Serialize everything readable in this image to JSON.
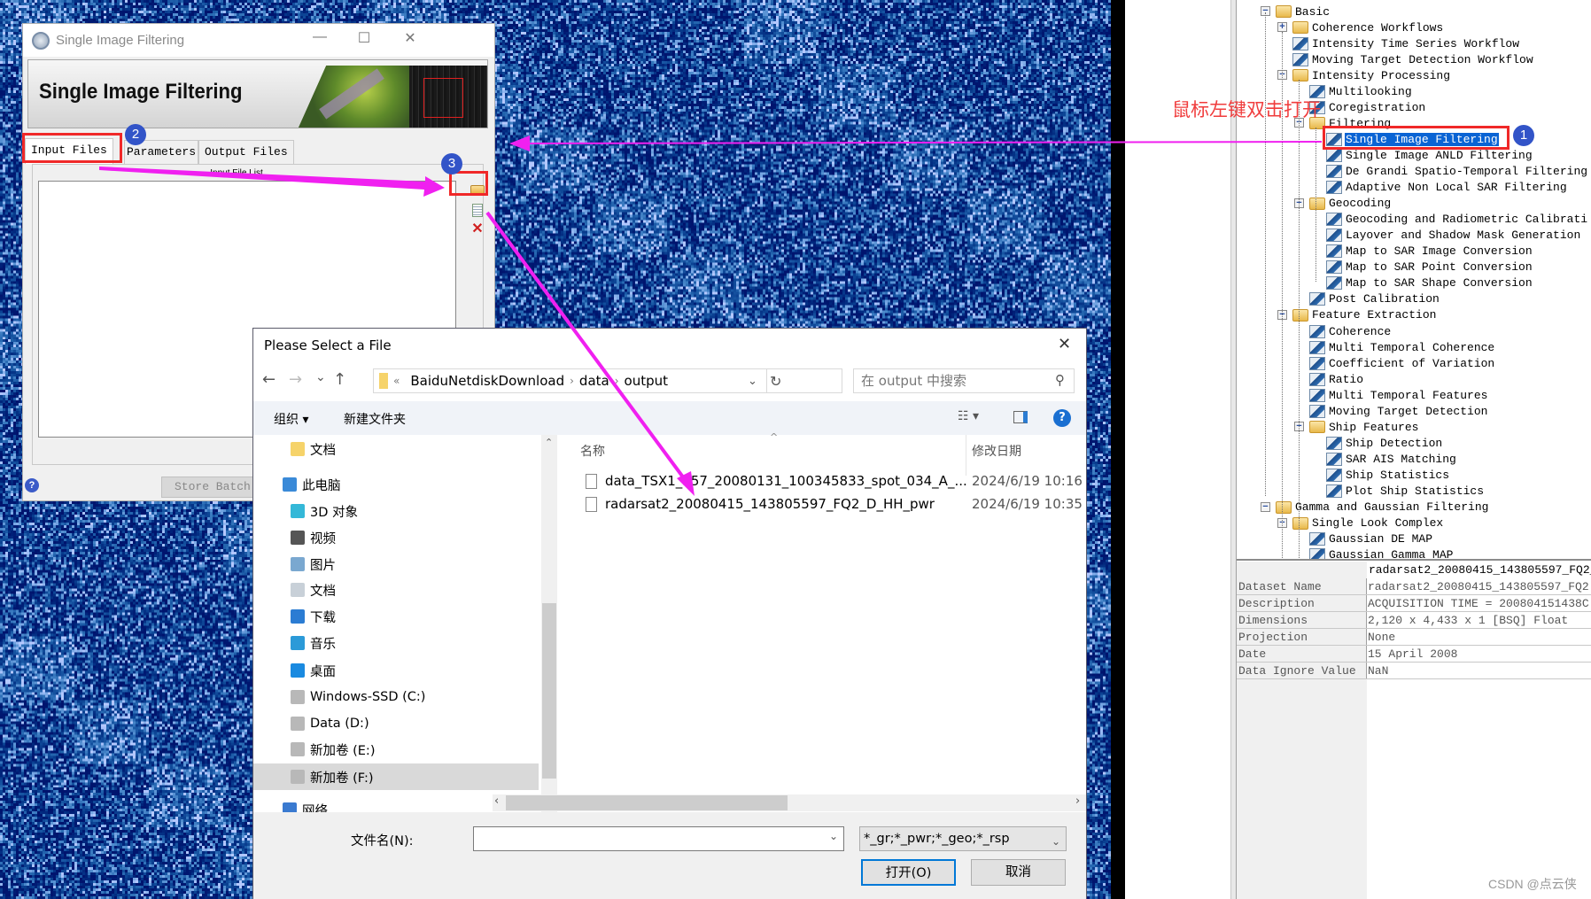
{
  "background_image": {
    "icon": "sar-intensity-image"
  },
  "annotation": {
    "instruction": "鼠标左键双击打开",
    "badges": [
      "1",
      "2",
      "3"
    ],
    "highlight_color": "#f02828",
    "arrow_color": "#f020f0"
  },
  "tree": {
    "items": [
      {
        "label": "Basic",
        "level": 0,
        "type": "folder",
        "expander": "−"
      },
      {
        "label": "Coherence Workflows",
        "level": 1,
        "type": "folder",
        "expander": "+"
      },
      {
        "label": "Intensity Time Series Workflow",
        "level": 1,
        "type": "tool"
      },
      {
        "label": "Moving Target Detection Workflow",
        "level": 1,
        "type": "tool"
      },
      {
        "label": "Intensity Processing",
        "level": 1,
        "type": "folder",
        "expander": "−"
      },
      {
        "label": "Multilooking",
        "level": 2,
        "type": "tool"
      },
      {
        "label": "Coregistration",
        "level": 2,
        "type": "tool"
      },
      {
        "label": "Filtering",
        "level": 2,
        "type": "folder",
        "expander": "−"
      },
      {
        "label": "Single Image Filtering",
        "level": 3,
        "type": "tool",
        "selected": true
      },
      {
        "label": "Single Image ANLD Filtering",
        "level": 3,
        "type": "tool"
      },
      {
        "label": "De Grandi Spatio-Temporal Filtering",
        "level": 3,
        "type": "tool"
      },
      {
        "label": "Adaptive Non Local SAR Filtering",
        "level": 3,
        "type": "tool"
      },
      {
        "label": "Geocoding",
        "level": 2,
        "type": "folder",
        "expander": "−"
      },
      {
        "label": "Geocoding and Radiometric Calibrati",
        "level": 3,
        "type": "tool"
      },
      {
        "label": "Layover and Shadow Mask Generation",
        "level": 3,
        "type": "tool"
      },
      {
        "label": "Map to SAR Image Conversion",
        "level": 3,
        "type": "tool"
      },
      {
        "label": "Map to SAR Point Conversion",
        "level": 3,
        "type": "tool"
      },
      {
        "label": "Map to SAR Shape Conversion",
        "level": 3,
        "type": "tool"
      },
      {
        "label": "Post Calibration",
        "level": 2,
        "type": "tool"
      },
      {
        "label": "Feature Extraction",
        "level": 1,
        "type": "folder",
        "expander": "−"
      },
      {
        "label": "Coherence",
        "level": 2,
        "type": "tool"
      },
      {
        "label": "Multi Temporal Coherence",
        "level": 2,
        "type": "tool"
      },
      {
        "label": "Coefficient of Variation",
        "level": 2,
        "type": "tool"
      },
      {
        "label": "Ratio",
        "level": 2,
        "type": "tool"
      },
      {
        "label": "Multi Temporal Features",
        "level": 2,
        "type": "tool"
      },
      {
        "label": "Moving Target Detection",
        "level": 2,
        "type": "tool"
      },
      {
        "label": "Ship Features",
        "level": 2,
        "type": "folder",
        "expander": "−"
      },
      {
        "label": "Ship Detection",
        "level": 3,
        "type": "tool"
      },
      {
        "label": "SAR AIS Matching",
        "level": 3,
        "type": "tool"
      },
      {
        "label": "Ship Statistics",
        "level": 3,
        "type": "tool"
      },
      {
        "label": "Plot Ship Statistics",
        "level": 3,
        "type": "tool"
      },
      {
        "label": "Gamma and Gaussian Filtering",
        "level": 0,
        "type": "folder",
        "expander": "−"
      },
      {
        "label": "Single Look Complex",
        "level": 1,
        "type": "folder",
        "expander": "−"
      },
      {
        "label": "Gaussian DE MAP",
        "level": 2,
        "type": "tool"
      },
      {
        "label": "Gaussian Gamma MAP",
        "level": 2,
        "type": "tool"
      }
    ]
  },
  "properties": {
    "header": "radarsat2_20080415_143805597_FQ2_",
    "rows": [
      {
        "label": "Dataset Name",
        "value": "radarsat2_20080415_143805597_FQ2"
      },
      {
        "label": "Description",
        "value": "ACQUISITION TIME = 200804151438C"
      },
      {
        "label": "Dimensions",
        "value": "2,120 x 4,433 x 1 [BSQ] Float"
      },
      {
        "label": "Projection",
        "value": "None"
      },
      {
        "label": "Date",
        "value": "15 April 2008"
      },
      {
        "label": "Data Ignore Value",
        "value": "NaN"
      }
    ]
  },
  "watermark": "CSDN @点云侠",
  "sif_dialog": {
    "window_title": "Single Image Filtering",
    "banner_title": "Single Image Filtering",
    "tabs": [
      "Input Files",
      "Parameters",
      "Output Files"
    ],
    "active_tab": "Input Files",
    "list_label": "Input File List",
    "store_batch": "Store Batch",
    "help": "?",
    "window_buttons": {
      "minimize": "—",
      "maximize": "☐",
      "close": "✕"
    }
  },
  "file_dialog": {
    "title": "Please Select a File",
    "close": "✕",
    "nav": {
      "back": "←",
      "forward": "→",
      "recent": "⌄",
      "up": "↑"
    },
    "breadcrumb": [
      "BaiduNetdiskDownload",
      "data",
      "output"
    ],
    "breadcrumb_overflow": "«",
    "search_placeholder": "在 output 中搜索",
    "toolbar": {
      "organize": "组织 ▾",
      "new_folder": "新建文件夹"
    },
    "nav_items": [
      {
        "label": "文档",
        "icon": "folder-icon",
        "indent": 2
      },
      {
        "label": "此电脑",
        "icon": "computer-icon",
        "indent": 1
      },
      {
        "label": "3D 对象",
        "icon": "3d-objects-icon",
        "indent": 2
      },
      {
        "label": "视频",
        "icon": "video-icon",
        "indent": 2
      },
      {
        "label": "图片",
        "icon": "pictures-icon",
        "indent": 2
      },
      {
        "label": "文档",
        "icon": "documents-icon",
        "indent": 2
      },
      {
        "label": "下载",
        "icon": "download-icon",
        "indent": 2
      },
      {
        "label": "音乐",
        "icon": "music-icon",
        "indent": 2
      },
      {
        "label": "桌面",
        "icon": "desktop-icon",
        "indent": 2
      },
      {
        "label": "Windows-SSD (C:)",
        "icon": "drive-icon",
        "indent": 2
      },
      {
        "label": "Data (D:)",
        "icon": "drive-icon",
        "indent": 2
      },
      {
        "label": "新加卷 (E:)",
        "icon": "drive-icon",
        "indent": 2
      },
      {
        "label": "新加卷 (F:)",
        "icon": "drive-icon",
        "indent": 2,
        "selected": true
      },
      {
        "label": "网络",
        "icon": "network-icon",
        "indent": 1
      }
    ],
    "columns": {
      "name": "名称",
      "modified": "修改日期"
    },
    "files": [
      {
        "name": "data_TSX1_557_20080131_100345833_spot_034_A_...",
        "modified": "2024/6/19 10:16"
      },
      {
        "name": "radarsat2_20080415_143805597_FQ2_D_HH_pwr",
        "modified": "2024/6/19 10:35"
      }
    ],
    "filename_label": "文件名(N):",
    "filename_value": "",
    "filter": "*_gr;*_pwr;*_geo;*_rsp",
    "open_button": "打开(O)",
    "cancel_button": "取消"
  }
}
